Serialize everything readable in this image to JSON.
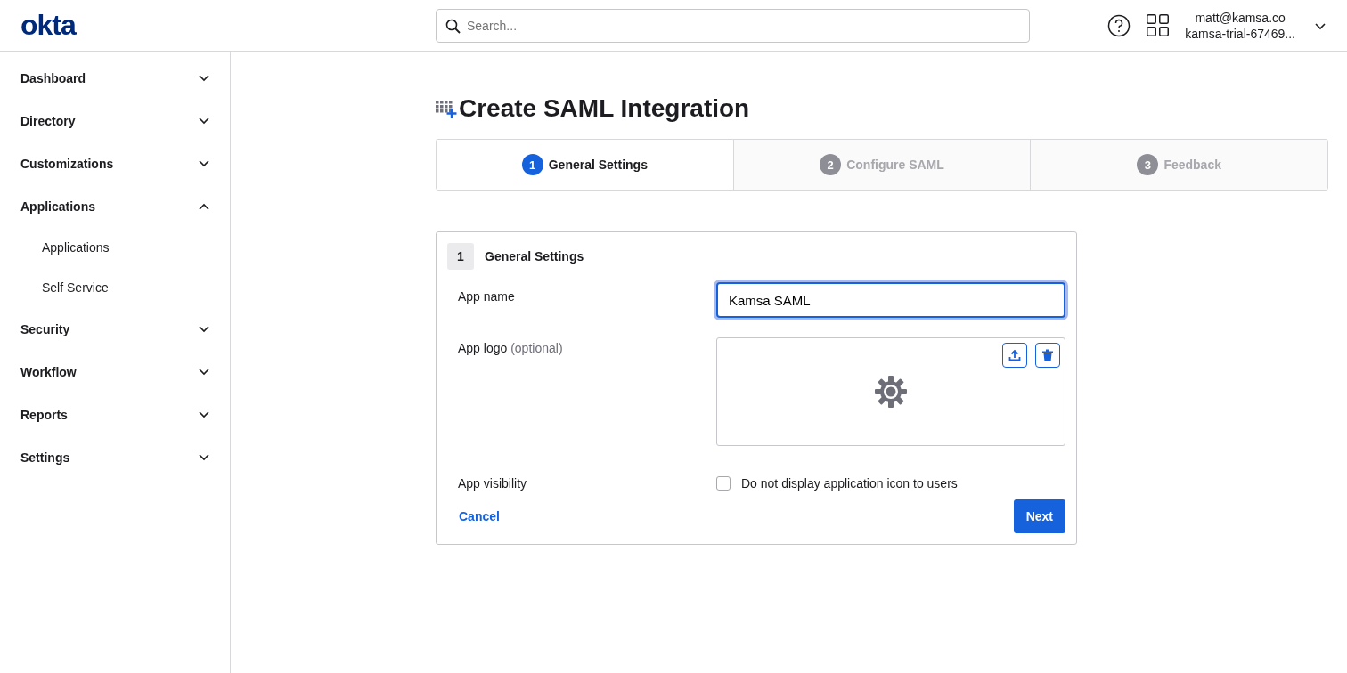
{
  "header": {
    "logo": "okta",
    "search": {
      "placeholder": "Search..."
    },
    "user": {
      "email": "matt@kamsa.co",
      "org": "kamsa-trial-67469..."
    }
  },
  "sidebar": {
    "items": [
      {
        "label": "Dashboard",
        "expanded": false
      },
      {
        "label": "Directory",
        "expanded": false
      },
      {
        "label": "Customizations",
        "expanded": false
      },
      {
        "label": "Applications",
        "expanded": true,
        "children": [
          {
            "label": "Applications"
          },
          {
            "label": "Self Service"
          }
        ]
      },
      {
        "label": "Security",
        "expanded": false
      },
      {
        "label": "Workflow",
        "expanded": false
      },
      {
        "label": "Reports",
        "expanded": false
      },
      {
        "label": "Settings",
        "expanded": false
      }
    ]
  },
  "page": {
    "title": "Create SAML Integration",
    "steps": [
      {
        "number": "1",
        "label": "General Settings",
        "selected": true
      },
      {
        "number": "2",
        "label": "Configure SAML",
        "selected": false
      },
      {
        "number": "3",
        "label": "Feedback",
        "selected": false
      }
    ],
    "form": {
      "section_number": "1",
      "section_title": "General Settings",
      "app_name": {
        "label": "App name",
        "value": "Kamsa SAML"
      },
      "app_logo": {
        "label": "App logo",
        "hint": "(optional)"
      },
      "app_visibility": {
        "label": "App visibility",
        "checkbox_label": "Do not display application icon to users",
        "checked": false
      },
      "cancel": "Cancel",
      "next": "Next"
    }
  }
}
